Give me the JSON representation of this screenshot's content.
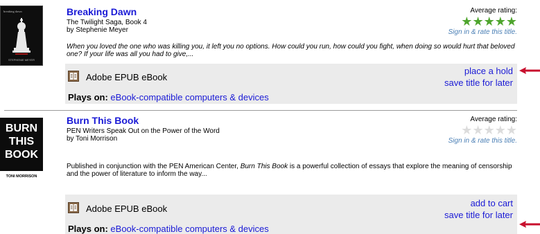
{
  "results": [
    {
      "title": "Breaking Dawn",
      "series": "The Twilight Saga, Book 4",
      "author": "by Stephenie Meyer",
      "cover_top_text": "breaking dawn",
      "cover_bottom_text": "STEPHENIE MEYER",
      "rating_label": "Average rating:",
      "rating": 5,
      "rating_max": 5,
      "sign_in": "Sign in & rate this title.",
      "description": "When you loved the one who was killing you, it left you no options. How could you run, how could you fight, when doing so would hurt that beloved one? If your life was all you had to give,...",
      "format": "Adobe EPUB eBook",
      "plays_label": "Plays on:",
      "plays_link": "eBook-compatible computers & devices",
      "action1": "place a hold",
      "action2": "save title for later"
    },
    {
      "title": "Burn This Book",
      "series": "PEN Writers Speak Out on the Power of the Word",
      "author": "by Toni Morrison",
      "cover_line1": "BURN",
      "cover_line2": "THIS",
      "cover_line3": "BOOK",
      "cover_author": "TONI MORRISON",
      "rating_label": "Average rating:",
      "rating": 0,
      "rating_max": 5,
      "sign_in": "Sign in & rate this title.",
      "description_before": "Published in conjunction with the PEN American Center, ",
      "description_em": "Burn This Book",
      "description_after": " is a powerful collection of essays that explore the meaning of censorship and the power of literature to inform the way...",
      "format": "Adobe EPUB eBook",
      "plays_label": "Plays on:",
      "plays_link": "eBook-compatible computers & devices",
      "action1": "add to cart",
      "action2": "save title for later"
    }
  ],
  "colors": {
    "link": "#1a1ad6",
    "star_filled": "#4ea52d",
    "star_empty": "#dcdcdc",
    "format_bg": "#ebebeb",
    "arrow": "#c8102e"
  },
  "icons": {
    "star": "star-icon",
    "book": "open-book-icon",
    "arrow": "left-arrow-icon"
  }
}
